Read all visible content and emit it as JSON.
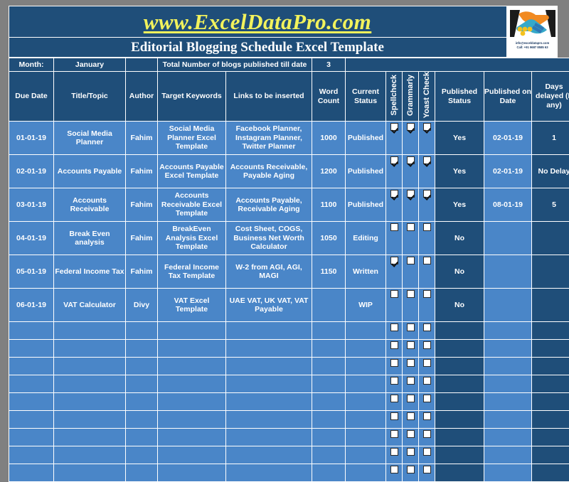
{
  "banner": {
    "url": "www.ExcelDataPro.com",
    "title": "Editorial Blogging Schedule Excel Template",
    "logo": {
      "alt": "handshake-logo",
      "email": "info@exceldatapro.com",
      "phone": "Call: +91 9687 8585 63"
    },
    "colors": {
      "dark_blue": "#1F4E79",
      "mid_blue": "#4A86C8",
      "yellow": "#F2F25C",
      "white": "#FFFFFF",
      "page_background": "#808080"
    }
  },
  "info_bar": {
    "month_label": "Month:",
    "month_value": "January",
    "total_label": "Total Number of blogs published till date",
    "total_value": "3"
  },
  "columns": [
    {
      "key": "due_date",
      "label": "Due Date"
    },
    {
      "key": "title_topic",
      "label": "Title/Topic"
    },
    {
      "key": "author",
      "label": "Author"
    },
    {
      "key": "target_keywords",
      "label": "Target Keywords"
    },
    {
      "key": "links",
      "label": "Links to be inserted"
    },
    {
      "key": "word_count",
      "label": "Word Count"
    },
    {
      "key": "current_status",
      "label": "Current Status"
    },
    {
      "key": "spellcheck",
      "label": "Spellcheck"
    },
    {
      "key": "grammarly",
      "label": "Grammarly"
    },
    {
      "key": "yoast_check",
      "label": "Yoast Check"
    },
    {
      "key": "published_status",
      "label": "Published Status"
    },
    {
      "key": "published_on",
      "label": "Published on Date"
    },
    {
      "key": "days_delayed",
      "label": "Days delayed (If any)"
    }
  ],
  "rows": [
    {
      "due_date": "01-01-19",
      "title_topic": "Social Media Planner",
      "author": "Fahim",
      "target_keywords": "Social Media Planner Excel Template",
      "links": "Facebook Planner, Instagram Planner, Twitter Planner",
      "word_count": "1000",
      "current_status": "Published",
      "spellcheck": true,
      "grammarly": true,
      "yoast_check": true,
      "published_status": "Yes",
      "published_on": "02-01-19",
      "days_delayed": "1"
    },
    {
      "due_date": "02-01-19",
      "title_topic": "Accounts Payable",
      "author": "Fahim",
      "target_keywords": "Accounts Payable Excel Template",
      "links": "Accounts Receivable, Payable Aging",
      "word_count": "1200",
      "current_status": "Published",
      "spellcheck": true,
      "grammarly": true,
      "yoast_check": true,
      "published_status": "Yes",
      "published_on": "02-01-19",
      "days_delayed": "No Delay"
    },
    {
      "due_date": "03-01-19",
      "title_topic": "Accounts Receivable",
      "author": "Fahim",
      "target_keywords": "Accounts Receivable Excel Template",
      "links": "Accounts Payable, Receivable Aging",
      "word_count": "1100",
      "current_status": "Published",
      "spellcheck": true,
      "grammarly": true,
      "yoast_check": true,
      "published_status": "Yes",
      "published_on": "08-01-19",
      "days_delayed": "5"
    },
    {
      "due_date": "04-01-19",
      "title_topic": "Break Even analysis",
      "author": "Fahim",
      "target_keywords": "BreakEven Analysis Excel Template",
      "links": "Cost Sheet, COGS, Business Net Worth Calculator",
      "word_count": "1050",
      "current_status": "Editing",
      "spellcheck": false,
      "grammarly": false,
      "yoast_check": false,
      "published_status": "No",
      "published_on": "",
      "days_delayed": ""
    },
    {
      "due_date": "05-01-19",
      "title_topic": "Federal Income Tax",
      "author": "Fahim",
      "target_keywords": "Federal Income Tax Template",
      "links": "W-2 from AGI, AGI, MAGI",
      "word_count": "1150",
      "current_status": "Written",
      "spellcheck": true,
      "grammarly": false,
      "yoast_check": false,
      "published_status": "No",
      "published_on": "",
      "days_delayed": ""
    },
    {
      "due_date": "06-01-19",
      "title_topic": "VAT Calculator",
      "author": "Divy",
      "target_keywords": "VAT Excel Template",
      "links": "UAE VAT, UK VAT, VAT Payable",
      "word_count": "",
      "current_status": "WIP",
      "spellcheck": false,
      "grammarly": false,
      "yoast_check": false,
      "published_status": "No",
      "published_on": "",
      "days_delayed": ""
    }
  ],
  "empty_row_count": 9
}
